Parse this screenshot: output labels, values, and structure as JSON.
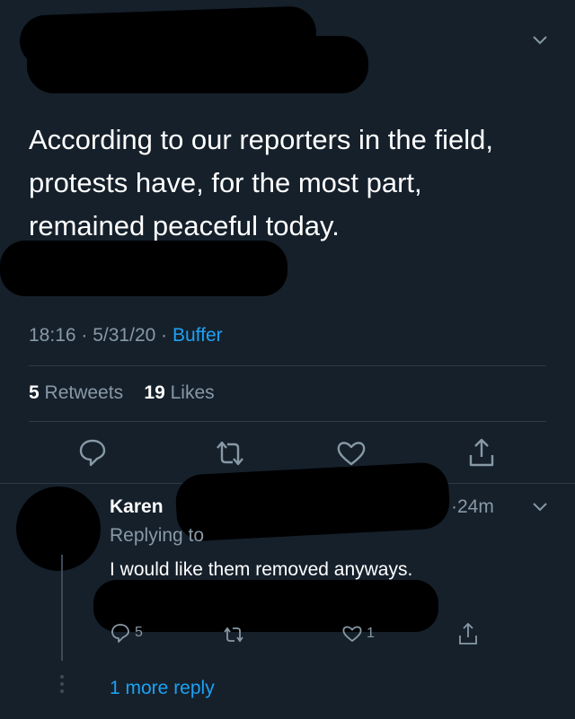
{
  "tweet": {
    "text": "According to our reporters in the field, protests have, for the most part, remained peaceful today.",
    "time": "18:16",
    "date": "5/31/20",
    "source": "Buffer",
    "retweets_count": "5",
    "retweets_label": "Retweets",
    "likes_count": "19",
    "likes_label": "Likes",
    "actions": [
      "reply-icon",
      "retweet-icon",
      "like-icon",
      "share-icon"
    ]
  },
  "reply": {
    "author": "Karen",
    "time": "24m",
    "replying_to_label": "Replying to",
    "text": "I would like them removed anyways.",
    "reply_count": "5",
    "like_count": "1",
    "more_replies": "1 more reply"
  },
  "colors": {
    "background": "#15202b",
    "secondary_text": "#8899a6",
    "accent": "#1da1f2",
    "redaction": "#000000"
  }
}
